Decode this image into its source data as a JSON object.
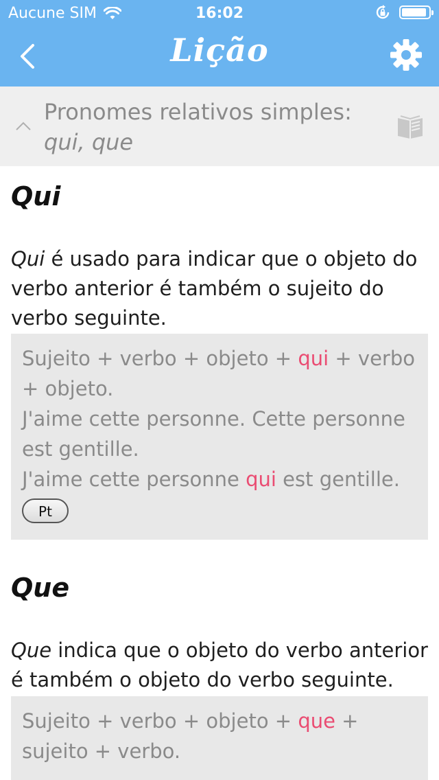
{
  "status_bar": {
    "carrier": "Aucune SIM",
    "time": "16:02",
    "battery_level": 0.92
  },
  "nav": {
    "title": "Lição",
    "back_icon": "chevron-left-icon",
    "settings_icon": "gear-icon"
  },
  "section": {
    "title_line1": "Pronomes relativos simples:",
    "title_line2": "qui, que",
    "collapse_icon": "chevron-up-icon",
    "book_icon": "book-icon"
  },
  "lesson": {
    "qui": {
      "heading": "Qui",
      "para_term": "Qui",
      "para_rest": " é usado para indicar que o objeto do verbo anterior é também o sujeito do verbo seguinte.",
      "example": {
        "line1_before": "Sujeito + verbo + objeto + ",
        "line1_hl": "qui",
        "line1_after": " + verbo + objeto.",
        "line2": "J'aime cette personne. Cette personne est gentille.",
        "line3_before": "J'aime cette personne ",
        "line3_hl": "qui",
        "line3_after": " est gentille.",
        "button_label": "Pt"
      }
    },
    "que": {
      "heading": "Que",
      "para_term": "Que",
      "para_rest": " indica que o objeto do verbo anterior é também o objeto do verbo seguinte.",
      "example": {
        "line1_before": "Sujeito + verbo + objeto + ",
        "line1_hl": "que",
        "line1_after": " + sujeito + verbo."
      }
    }
  },
  "colors": {
    "header_blue": "#6ab4f0",
    "section_bg": "#efefef",
    "example_bg": "#e8e8e8",
    "highlight": "#ea4c72"
  }
}
